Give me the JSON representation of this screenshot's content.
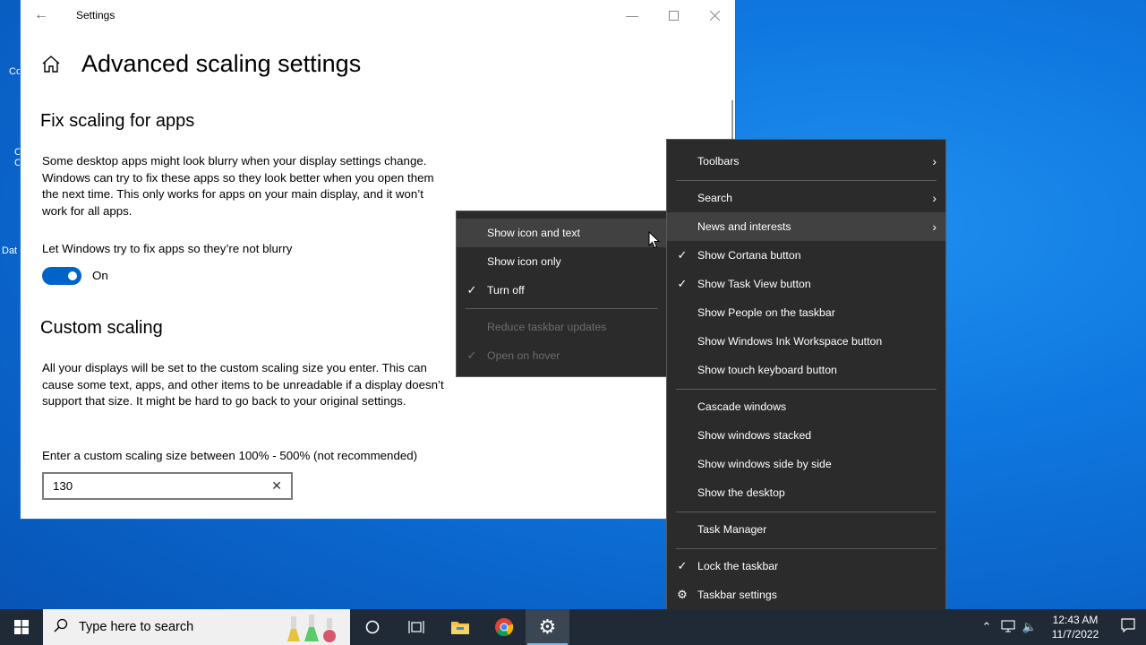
{
  "desktop": {
    "partial_labels": [
      "Co",
      "C",
      "C",
      "Dat"
    ]
  },
  "settings": {
    "window_title": "Settings",
    "page_title": "Advanced scaling settings",
    "fix_section": {
      "title": "Fix scaling for apps",
      "description": "Some desktop apps might look blurry when your display settings change. Windows can try to fix these apps so they look better when you open them the next time. This only works for apps on your main display, and it won’t work for all apps.",
      "toggle_label": "Let Windows try to fix apps so they’re not blurry",
      "toggle_state": "On",
      "toggle_on": true
    },
    "custom_section": {
      "title": "Custom scaling",
      "description": "All your displays will be set to the custom scaling size you enter. This can cause some text, apps, and other items to be unreadable if a display doesn’t support that size. It might be hard to go back to your original settings.",
      "input_label": "Enter a custom scaling size between 100% - 500% (not recommended)",
      "input_value": "130"
    }
  },
  "submenu": {
    "items": [
      {
        "label": "Show icon and text",
        "checked": false,
        "highlighted": true,
        "disabled": false
      },
      {
        "label": "Show icon only",
        "checked": false,
        "highlighted": false,
        "disabled": false
      },
      {
        "label": "Turn off",
        "checked": true,
        "highlighted": false,
        "disabled": false
      },
      {
        "label": "Reduce taskbar updates",
        "checked": false,
        "highlighted": false,
        "disabled": true
      },
      {
        "label": "Open on hover",
        "checked": true,
        "highlighted": false,
        "disabled": true
      }
    ]
  },
  "context_menu": {
    "items": [
      {
        "label": "Toolbars",
        "has_submenu": true
      },
      {
        "label": "Search",
        "has_submenu": true
      },
      {
        "label": "News and interests",
        "has_submenu": true,
        "highlighted": true
      },
      {
        "label": "Show Cortana button",
        "checked": true
      },
      {
        "label": "Show Task View button",
        "checked": true
      },
      {
        "label": "Show People on the taskbar"
      },
      {
        "label": "Show Windows Ink Workspace button"
      },
      {
        "label": "Show touch keyboard button"
      },
      {
        "label": "Cascade windows"
      },
      {
        "label": "Show windows stacked"
      },
      {
        "label": "Show windows side by side"
      },
      {
        "label": "Show the desktop"
      },
      {
        "label": "Task Manager"
      },
      {
        "label": "Lock the taskbar",
        "checked": true
      },
      {
        "label": "Taskbar settings",
        "icon": "gear-icon"
      }
    ]
  },
  "taskbar": {
    "search_placeholder": "Type here to search",
    "apps": [
      "cortana-icon",
      "task-view-icon",
      "file-explorer-icon",
      "chrome-icon",
      "settings-gear-icon"
    ],
    "clock_time": "12:43 AM",
    "clock_date": "11/7/2022"
  },
  "colors": {
    "accent": "#0063c7",
    "menu_bg": "#2b2b2b",
    "menu_highlight": "#414141",
    "taskbar_bg": "#1f2a36",
    "desktop_blue": "#0f78e0"
  }
}
